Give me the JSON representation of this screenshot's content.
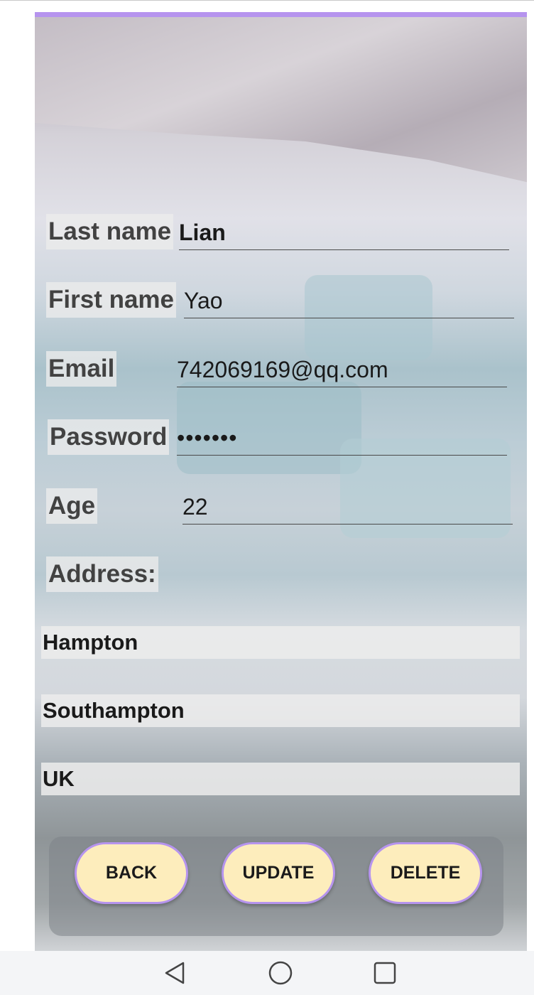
{
  "form": {
    "last_name_label": "Last name",
    "last_name_value": "Lian",
    "first_name_label": "First name",
    "first_name_value": "Yao",
    "email_label": "Email",
    "email_value": "742069169@qq.com",
    "password_label": "Password",
    "password_value": "•••••••",
    "age_label": "Age",
    "age_value": "22",
    "address_label": "Address:"
  },
  "address_lines": [
    "Hampton",
    "Southampton",
    "UK"
  ],
  "buttons": {
    "back": "BACK",
    "update": "UPDATE",
    "delete": "DELETE"
  },
  "nav": {
    "icons": [
      "back-triangle-icon",
      "home-circle-icon",
      "recents-square-icon"
    ]
  },
  "colors": {
    "accent": "#b694ee",
    "button_fill": "#fdedbc",
    "label_bg": "#ececec"
  }
}
